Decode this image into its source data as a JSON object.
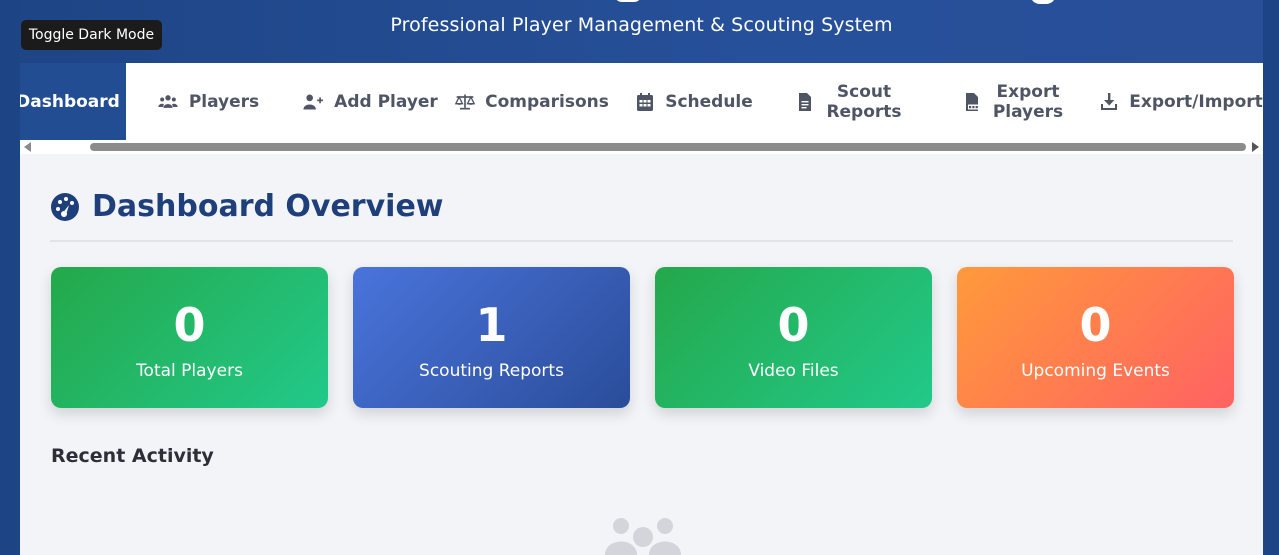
{
  "header": {
    "subtitle": "Professional Player Management & Scouting System",
    "toggle_label": "Toggle Dark Mode"
  },
  "nav": {
    "items": [
      {
        "label": "Dashboard",
        "icon": "dashboard-icon",
        "active": true
      },
      {
        "label": "Players",
        "icon": "users-icon"
      },
      {
        "label": "Add Player",
        "icon": "user-plus-icon"
      },
      {
        "label": "Comparisons",
        "icon": "balance-scale-icon"
      },
      {
        "label": "Schedule",
        "icon": "calendar-icon"
      },
      {
        "label_line1": "Scout",
        "label_line2": "Reports",
        "icon": "file-icon"
      },
      {
        "label_line1": "Export",
        "label_line2": "Players",
        "icon": "pdf-file-icon"
      },
      {
        "label": "Export/Import",
        "icon": "download-icon"
      }
    ]
  },
  "main": {
    "title": "Dashboard Overview",
    "title_icon": "tachometer-icon",
    "stats": [
      {
        "value": "0",
        "label": "Total Players",
        "color": "#24a84a"
      },
      {
        "value": "1",
        "label": "Scouting Reports",
        "color": "#3b62c0"
      },
      {
        "value": "0",
        "label": "Video Files",
        "color": "#24a84a"
      },
      {
        "value": "0",
        "label": "Upcoming Events",
        "color": "#ff8050"
      }
    ],
    "recent_activity_heading": "Recent Activity",
    "empty_icon": "users-icon"
  },
  "colors": {
    "header_bg": "#234d93",
    "nav_active_bg": "#234d93",
    "title_color": "#1f3f7a",
    "content_bg": "#f3f4f8"
  }
}
